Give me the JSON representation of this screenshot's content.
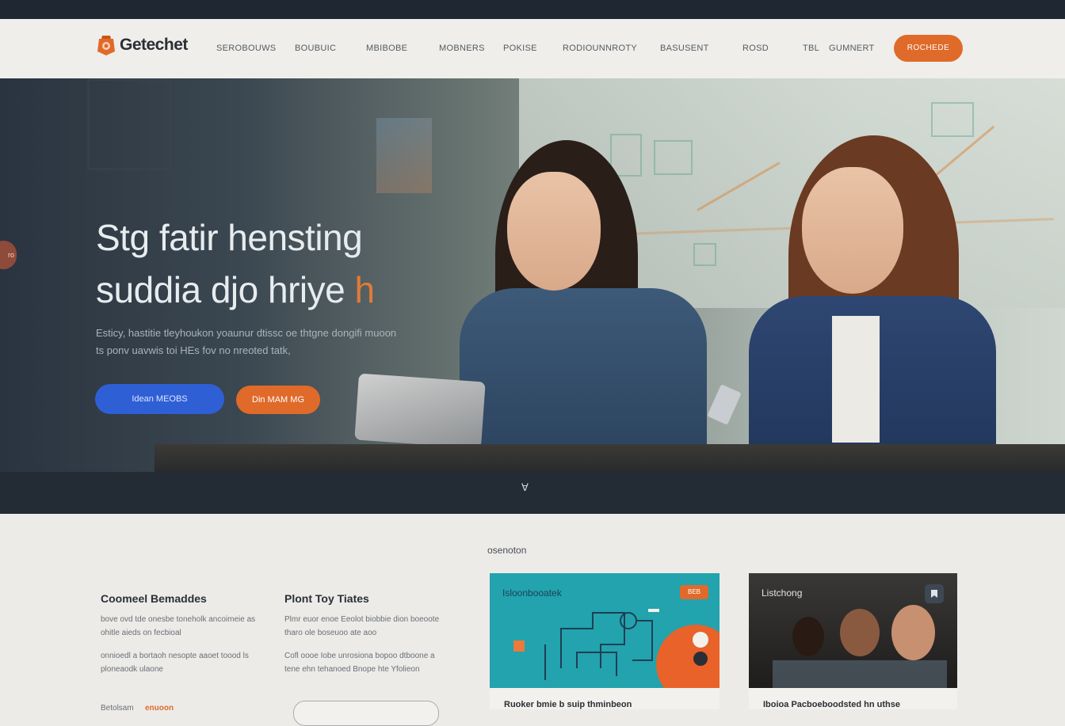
{
  "topbar": {
    "links": [
      "",
      "",
      "",
      ""
    ]
  },
  "nav": {
    "brand": "Getechet",
    "links": [
      "SEROBOUWS",
      "BOUBUIC",
      "MBIBOBE",
      "MOBNERS",
      "POKISE",
      "RODIOUNNROTY",
      "BASUSENT",
      "ROSD",
      "TBL",
      "GUMNERT"
    ],
    "cta_label": "ROCHEDE"
  },
  "hero": {
    "title_line1": "Stg fatir hensting",
    "title_line2": "suddia djo hriye",
    "title_accent": "h",
    "body_line1": "Esticy, hastitie tleyhoukon yoaunur dtissc oe thtgne dongifi muoon",
    "body_line2": "ts ponv uavwis toi HEs fov no  nreoted tatk,",
    "primary_button": "Idean MEOBS",
    "secondary_button": "Din MAM MG",
    "carousel_indicator": "∀",
    "side_tab_label": "ro"
  },
  "section": {
    "kicker": "osenoton",
    "features": [
      {
        "title": "Coomeel Bemaddes",
        "para1": "bove ovd tde onesbe toneholk ancoimeie as ohitle aieds on fecbioal",
        "para2": "onnioedl a bortaoh nesopte aaoet toood ls ploneaodk ulaone",
        "tag_prefix": "Betolsam",
        "tag_accent": "enuoon"
      },
      {
        "title": "Plont Toy Tiates",
        "para1": "Plmr euor enoe Eeolot biobbie dion boeoote tharo ole boseuoo ate aoo",
        "para2": "Cofl oooe Iobe unrosiona bopoo dtboone a tene ehn tehanoed Bnope hte Yfolieon"
      }
    ],
    "cards": [
      {
        "label": "Isloonbooatek",
        "caption": "Ruoker bmie b suip thminbeon",
        "badge": "BEB"
      },
      {
        "label": "Listchong",
        "caption": "Iboioa Pacboeboodsted hn uthse"
      }
    ]
  },
  "colors": {
    "accent_orange": "#e06a2a",
    "primary_blue": "#2f5fd4",
    "dark_navy": "#232b35",
    "page_bg": "#ecebe8",
    "card_teal": "#22a3ad"
  }
}
